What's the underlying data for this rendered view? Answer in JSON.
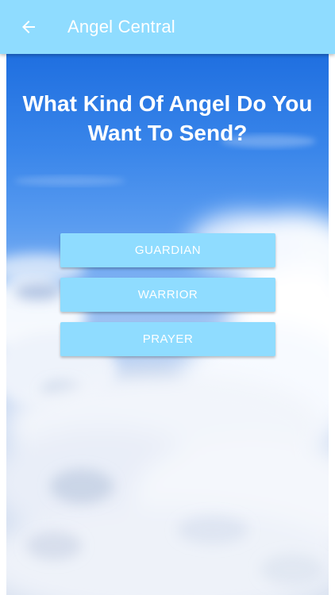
{
  "app_bar": {
    "title": "Angel Central",
    "back_icon": "arrow-left-icon",
    "color": "#8fdcff"
  },
  "main": {
    "question": "What Kind Of Angel Do You Want To Send?",
    "choices": [
      {
        "label": "GUARDIAN"
      },
      {
        "label": "WARRIOR"
      },
      {
        "label": "PRAYER"
      }
    ],
    "button_color": "#8fdcff"
  }
}
